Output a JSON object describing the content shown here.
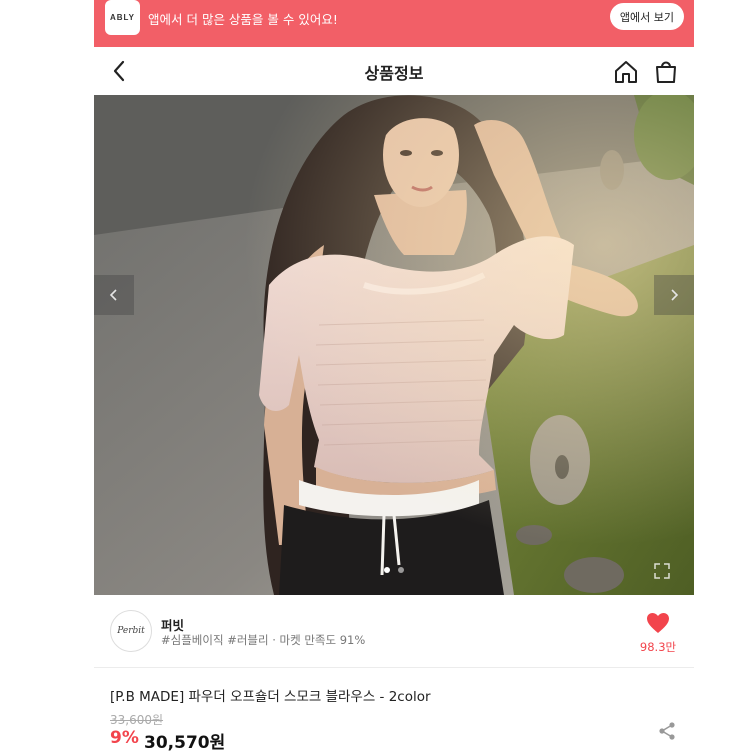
{
  "banner": {
    "app_logo": "ABLY",
    "text": "앱에서 더 많은 상품을 볼 수 있어요!",
    "button_label": "앱에서 보기"
  },
  "header": {
    "title": "상품정보",
    "icons": [
      "chevron-left-icon",
      "home-icon",
      "shopping-bag-icon"
    ]
  },
  "gallery": {
    "image_count": 2,
    "active_index": 0
  },
  "seller": {
    "logo_text": "Perbit",
    "name": "퍼빗",
    "tags": "#심플베이직 #러블리 · 마켓 만족도 91%",
    "likes": "98.3만"
  },
  "product": {
    "name": "[P.B MADE] 파우더 오프숄더 스모크 블라우스 - 2color",
    "original_price": "33,600원",
    "discount": "9%",
    "price": "30,570원"
  },
  "colors": {
    "banner": "#f25f67",
    "accent": "#f2444c"
  }
}
